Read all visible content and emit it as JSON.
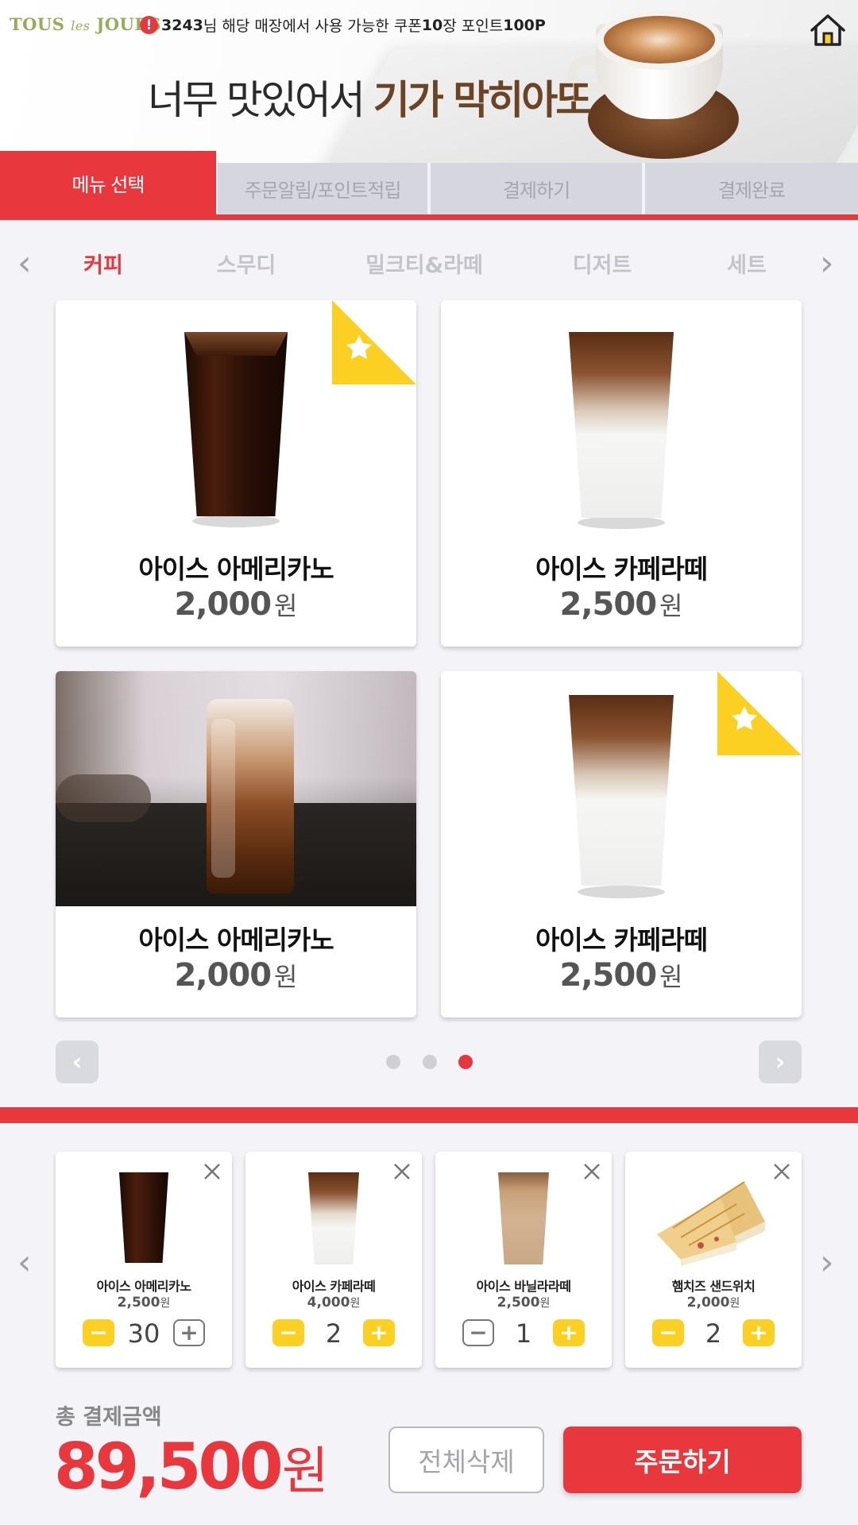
{
  "header": {
    "logo_main": "TOUS",
    "logo_mid": "les",
    "logo_end": "JOURS",
    "notice_icon": "!",
    "notice_user": "3243",
    "notice_text_1": "님 해당 매장에서 사용 가능한 쿠폰 ",
    "notice_coupon": "10",
    "notice_text_2": "장 포인트 ",
    "notice_points": "100P",
    "slogan_plain": "너무 맛있어서 ",
    "slogan_bold": "기가 막히아또"
  },
  "steps": [
    {
      "label": "메뉴 선택",
      "active": true
    },
    {
      "label": "주문알림/포인트적립",
      "active": false
    },
    {
      "label": "결제하기",
      "active": false
    },
    {
      "label": "결제완료",
      "active": false
    }
  ],
  "categories": [
    "커피",
    "스무디",
    "밀크티&라떼",
    "디저트",
    "세트"
  ],
  "menu": [
    {
      "name": "아이스 아메리카노",
      "price": "2,000",
      "unit": "원",
      "starred": true
    },
    {
      "name": "아이스 카페라떼",
      "price": "2,500",
      "unit": "원",
      "starred": false
    },
    {
      "name": "아이스 아메리카노",
      "price": "2,000",
      "unit": "원",
      "starred": false
    },
    {
      "name": "아이스 카페라떼",
      "price": "2,500",
      "unit": "원",
      "starred": true
    }
  ],
  "pager": {
    "prev": "‹",
    "next": "›",
    "pages": 3,
    "current": 3
  },
  "cart": [
    {
      "name": "아이스 아메리카노",
      "price": "2,500",
      "unit": "원",
      "qty": "30"
    },
    {
      "name": "아이스 카페라떼",
      "price": "4,000",
      "unit": "원",
      "qty": "2"
    },
    {
      "name": "아이스 바닐라라떼",
      "price": "2,500",
      "unit": "원",
      "qty": "1"
    },
    {
      "name": "햄치즈 샌드위치",
      "price": "2,000",
      "unit": "원",
      "qty": "2"
    }
  ],
  "total": {
    "label": "총 결제금액",
    "amount": "89,500",
    "unit": "원"
  },
  "actions": {
    "clear": "전체삭제",
    "order": "주문하기"
  },
  "colors": {
    "accent": "#e8383d",
    "yellow": "#fcd022",
    "logo": "#94ad5a",
    "slogan_bold": "#6b4426"
  }
}
